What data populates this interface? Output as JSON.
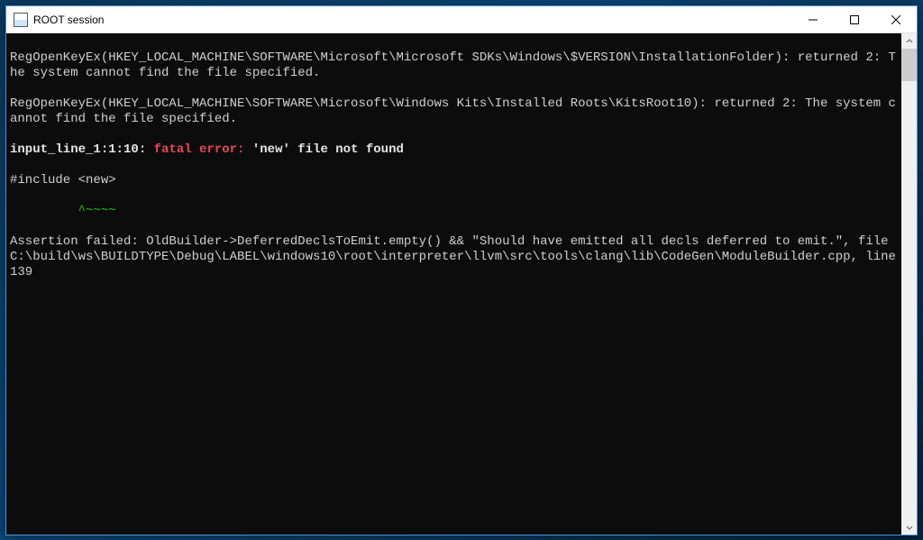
{
  "window": {
    "title": "ROOT session"
  },
  "console": {
    "lines": {
      "l1": "RegOpenKeyEx(HKEY_LOCAL_MACHINE\\SOFTWARE\\Microsoft\\Microsoft SDKs\\Windows\\$VERSION\\InstallationFolder): returned 2: The system cannot find the file specified.",
      "l2": "RegOpenKeyEx(HKEY_LOCAL_MACHINE\\SOFTWARE\\Microsoft\\Windows Kits\\Installed Roots\\KitsRoot10): returned 2: The system cannot find the file specified.",
      "l3_prefix": "input_line_1:1:10: ",
      "l3_fatal": "fatal error: ",
      "l3_rest": "'new' file not found",
      "l4": "#include <new>",
      "l5_pad": "         ",
      "l5_marker": "^~~~~",
      "l6": "Assertion failed: OldBuilder->DeferredDeclsToEmit.empty() && \"Should have emitted all decls deferred to emit.\", file C:\\build\\ws\\BUILDTYPE\\Debug\\LABEL\\windows10\\root\\interpreter\\llvm\\src\\tools\\clang\\lib\\CodeGen\\ModuleBuilder.cpp, line 139"
    }
  }
}
